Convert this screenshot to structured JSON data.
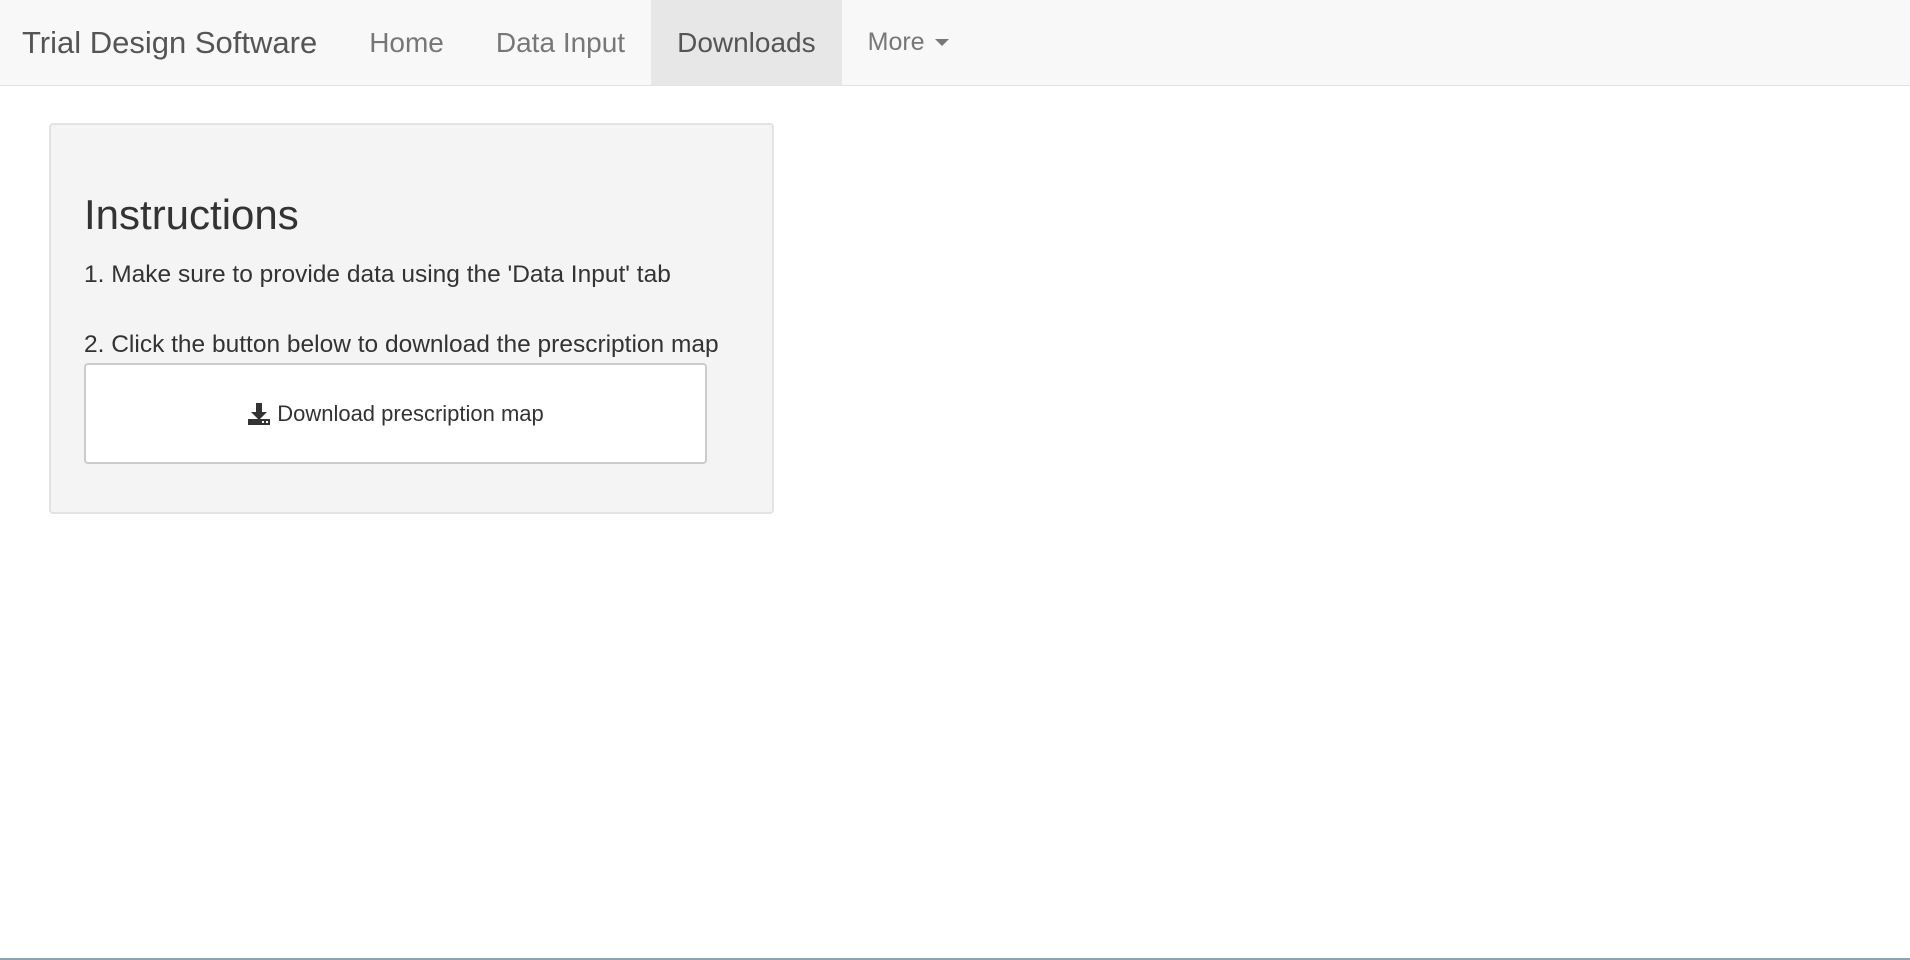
{
  "navbar": {
    "brand": "Trial Design Software",
    "items": [
      {
        "label": "Home"
      },
      {
        "label": "Data Input"
      },
      {
        "label": "Downloads"
      },
      {
        "label": "More"
      }
    ],
    "active": "Downloads",
    "more_icon": "caret-down-icon"
  },
  "panel": {
    "title": "Instructions",
    "step1": "1. Make sure to provide data using the 'Data Input' tab",
    "step2": "2. Click the button below to download the prescription map",
    "download_button_label": "Download prescription map",
    "download_icon": "download-icon"
  },
  "colors": {
    "navbar_bg": "#f8f8f8",
    "active_tab_bg": "#e7e7e7",
    "panel_bg": "#f4f4f4"
  }
}
